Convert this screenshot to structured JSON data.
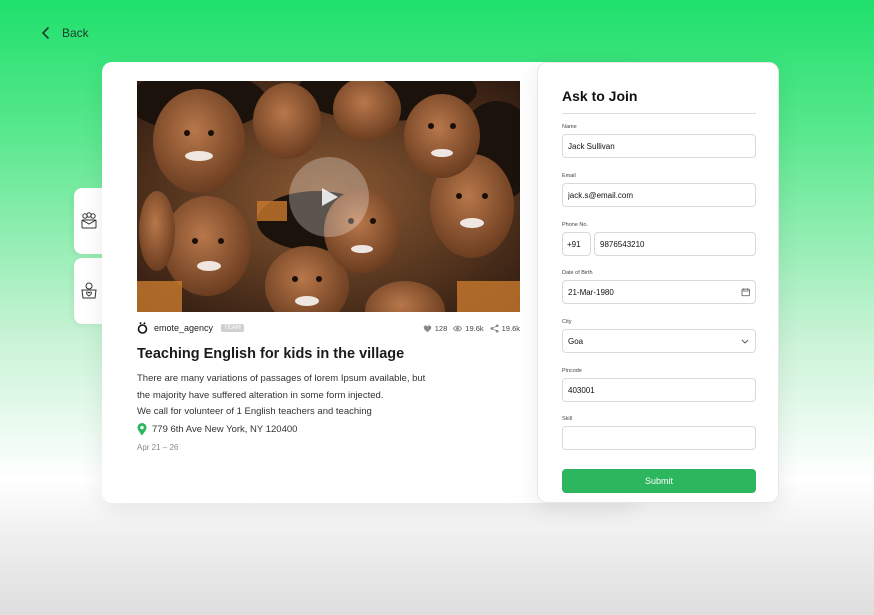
{
  "nav": {
    "back_label": "Back"
  },
  "side_tabs": [
    {
      "icon": "group-icon"
    },
    {
      "icon": "donation-icon"
    }
  ],
  "post": {
    "author": "emote_agency",
    "badge": "TEAM",
    "likes": "128",
    "views": "19.6k",
    "shares": "19.6k",
    "title": "Teaching English for kids in the village",
    "description_lines": [
      "There are many variations of passages of lorem Ipsum available, but",
      "the majority have suffered alteration in some form injected.",
      "We call for volunteer of 1 English teachers and teaching"
    ],
    "location": "779 6th Ave New York, NY 120400",
    "dates": "Apr 21 – 26"
  },
  "form": {
    "title": "Ask to Join",
    "name_label": "Name",
    "name_value": "Jack Sullivan",
    "email_label": "Email",
    "email_value": "jack.s@email.com",
    "phone_label": "Phone No.",
    "phone_code": "+91",
    "phone_value": "9876543210",
    "dob_label": "Date of Birth",
    "dob_value": "21-Mar-1980",
    "city_label": "City",
    "city_value": "Goa",
    "pincode_label": "Pincode",
    "pincode_value": "403001",
    "skill_label": "Skill",
    "skill_value": "",
    "submit_label": "Submit"
  },
  "colors": {
    "accent": "#2cb65e",
    "bg_top": "#1fe06c"
  }
}
